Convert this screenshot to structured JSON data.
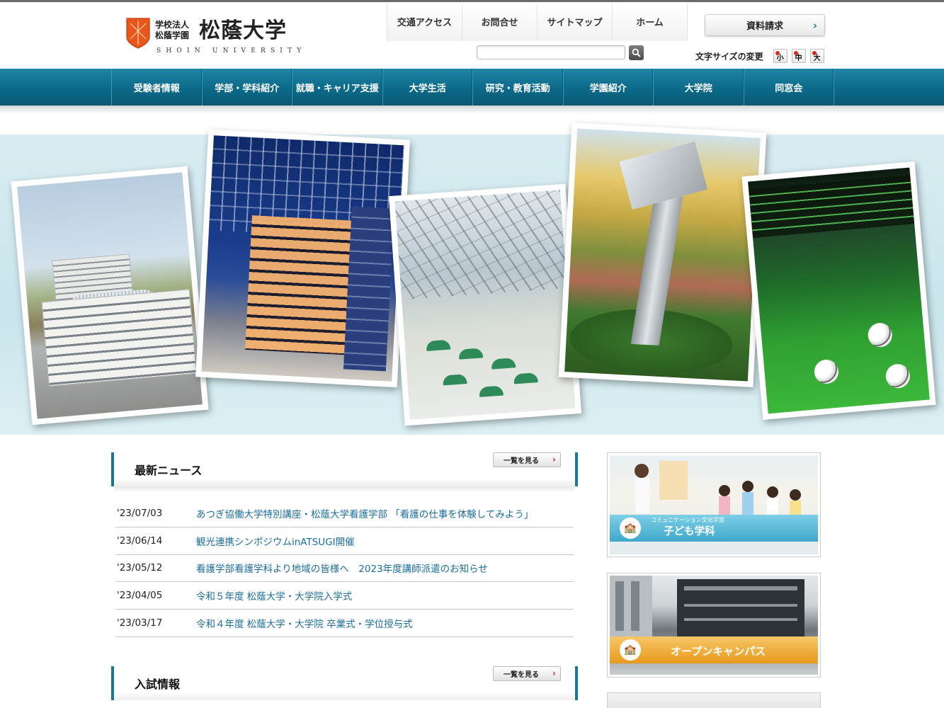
{
  "header": {
    "logo": {
      "corp_line1": "学校法人",
      "corp_line2": "松蔭学園",
      "name": "松蔭大学",
      "name_en": "SHOIN UNIVERSITY"
    },
    "util_nav": [
      "交通アクセス",
      "お問合せ",
      "サイトマップ",
      "ホーム"
    ],
    "request_button": "資料請求",
    "search": {
      "value": "",
      "placeholder": ""
    },
    "font_size": {
      "label": "文字サイズの変更",
      "small": "小",
      "medium": "中",
      "large": "大"
    }
  },
  "global_nav": [
    "受験者情報",
    "学部・学科紹介",
    "就職・キャリア支援",
    "大学生活",
    "研究・教育活動",
    "学園紹介",
    "大学院",
    "同窓会"
  ],
  "news": {
    "title": "最新ニュース",
    "more_label": "一覧を見る",
    "items": [
      {
        "date": "'23/07/03",
        "title": "あつぎ協働大学特別講座・松蔭大学看護学部 「看護の仕事を体験してみよう」"
      },
      {
        "date": "'23/06/14",
        "title": "観光連携シンポジウムinATSUGI開催"
      },
      {
        "date": "'23/05/12",
        "title": "看護学部看護学科より地域の皆様へ　2023年度講師派遣のお知らせ"
      },
      {
        "date": "'23/04/05",
        "title": "令和５年度 松蔭大学・大学院入学式"
      },
      {
        "date": "'23/03/17",
        "title": "令和４年度 松蔭大学・大学院 卒業式・学位授与式"
      }
    ]
  },
  "exam": {
    "title": "入試情報",
    "more_label": "一覧を見る"
  },
  "sidebar": {
    "kids_banner": {
      "subtitle": "コミュニケーション文化学部",
      "title": "子ども学科"
    },
    "opencampus_banner": {
      "title": "オープンキャンパス"
    }
  },
  "colors": {
    "nav_teal": "#0c6a89",
    "link": "#1b6e9c",
    "accent_red": "#d42a1e",
    "logo_orange": "#e8561c"
  }
}
